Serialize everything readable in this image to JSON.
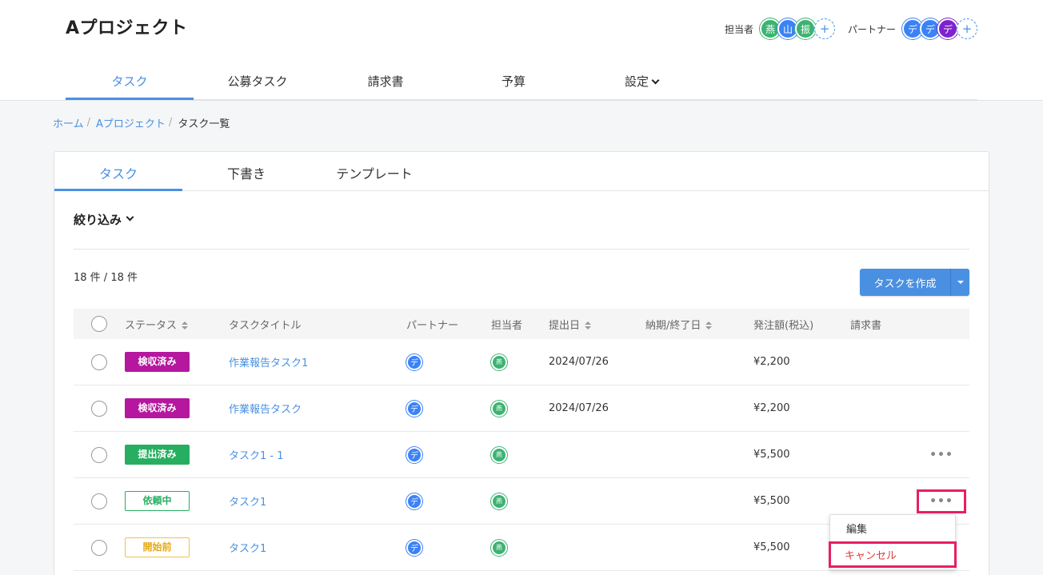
{
  "header": {
    "project_title": "Aプロジェクト",
    "assignee_label": "担当者",
    "assignees": [
      {
        "text": "燕",
        "color": "green"
      },
      {
        "text": "山",
        "color": "blue"
      },
      {
        "text": "振",
        "color": "green"
      }
    ],
    "partner_label": "パートナー",
    "partners": [
      {
        "text": "デ",
        "color": "blue"
      },
      {
        "text": "デ",
        "color": "blue"
      },
      {
        "text": "デ",
        "color": "purple"
      }
    ],
    "add_symbol": "+"
  },
  "nav": {
    "items": [
      "タスク",
      "公募タスク",
      "請求書",
      "予算",
      "設定"
    ],
    "active_index": 0
  },
  "breadcrumb": {
    "home": "ホーム",
    "project": "Aプロジェクト",
    "current": "タスク一覧",
    "separator": "/"
  },
  "tabs": {
    "items": [
      "タスク",
      "下書き",
      "テンプレート"
    ],
    "active_index": 0
  },
  "filter_label": "絞り込み",
  "count_text": "18 件 / 18 件",
  "create_button_label": "タスクを作成",
  "table": {
    "headers": {
      "status": "ステータス",
      "title": "タスクタイトル",
      "partner": "パートナー",
      "assignee": "担当者",
      "submit_date": "提出日",
      "due_date": "納期/終了日",
      "amount": "発注額(税込)",
      "invoice": "請求書"
    },
    "rows": [
      {
        "status": "検収済み",
        "status_style": "purple",
        "title": "作業報告タスク1",
        "partner": "デ",
        "assignee": "燕",
        "submit_date": "2024/07/26",
        "due_date": "",
        "amount": "¥2,200",
        "has_more": false
      },
      {
        "status": "検収済み",
        "status_style": "purple",
        "title": "作業報告タスク",
        "partner": "デ",
        "assignee": "燕",
        "submit_date": "2024/07/26",
        "due_date": "",
        "amount": "¥2,200",
        "has_more": false
      },
      {
        "status": "提出済み",
        "status_style": "green",
        "title": "タスク1 - 1",
        "partner": "デ",
        "assignee": "燕",
        "submit_date": "",
        "due_date": "",
        "amount": "¥5,500",
        "has_more": true
      },
      {
        "status": "依頼中",
        "status_style": "green-o",
        "title": "タスク1",
        "partner": "デ",
        "assignee": "燕",
        "submit_date": "",
        "due_date": "",
        "amount": "¥5,500",
        "has_more": true
      },
      {
        "status": "開始前",
        "status_style": "yellow-o",
        "title": "タスク1",
        "partner": "デ",
        "assignee": "燕",
        "submit_date": "",
        "due_date": "",
        "amount": "¥5,500",
        "has_more": false
      }
    ]
  },
  "more_symbol": "•••",
  "dropdown": {
    "edit": "編集",
    "cancel": "キャンセル"
  }
}
